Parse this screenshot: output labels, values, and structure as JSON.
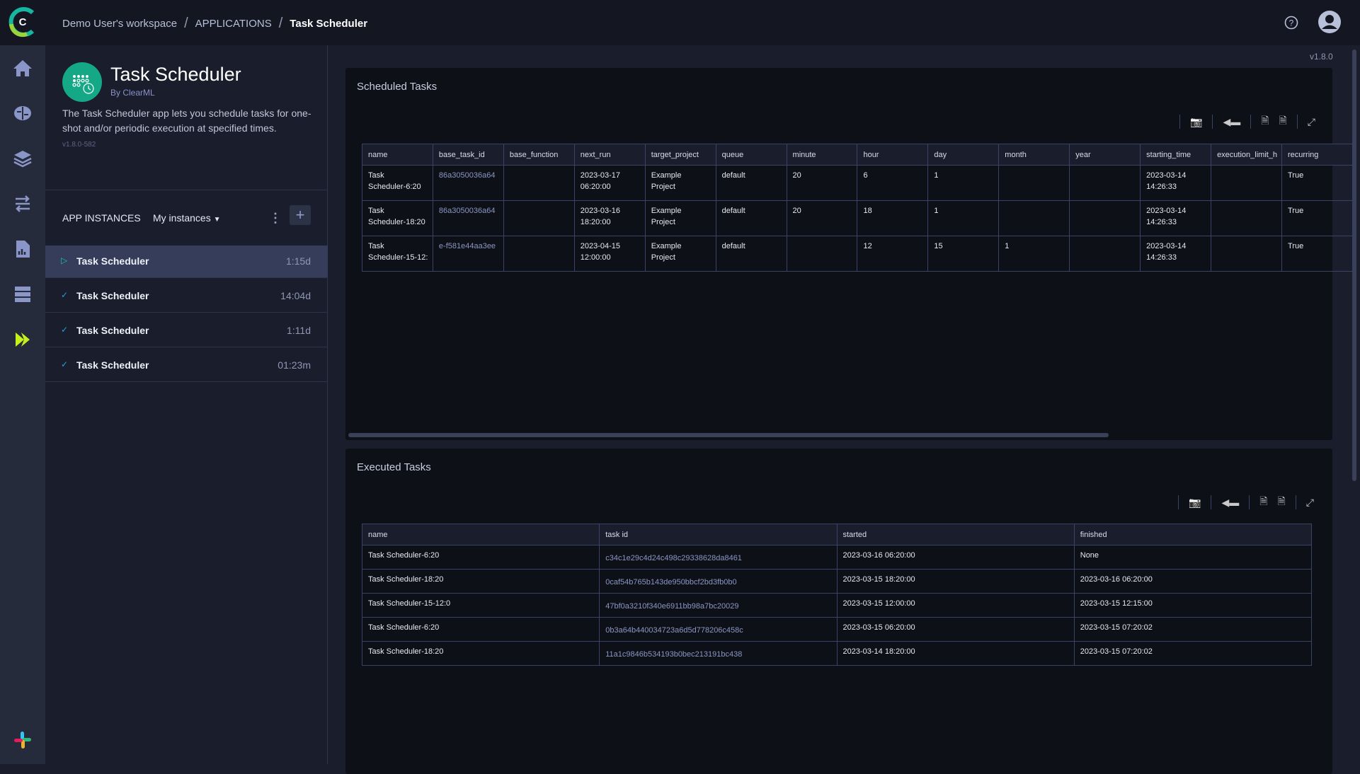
{
  "breadcrumb": {
    "workspace": "Demo User's workspace",
    "section": "APPLICATIONS",
    "current": "Task Scheduler"
  },
  "topbar": {
    "help_icon": "help-circle-icon",
    "avatar_icon": "user-avatar-icon"
  },
  "nav": [
    "home-icon",
    "brain-icon",
    "layers-icon",
    "pipelines-icon",
    "reports-icon",
    "datasets-icon",
    "applications-icon",
    "slack-icon"
  ],
  "app": {
    "title": "Task Scheduler",
    "by": "By ClearML",
    "description": "The Task Scheduler app lets you schedule tasks for one-shot and/or periodic execution at specified times.",
    "version": "v1.8.0-582"
  },
  "instances": {
    "header": "APP INSTANCES",
    "filter": "My instances",
    "add": "+",
    "kebab": "⋮",
    "items": [
      {
        "name": "Task Scheduler",
        "time": "1:15d",
        "status": "running"
      },
      {
        "name": "Task Scheduler",
        "time": "14:04d",
        "status": "completed"
      },
      {
        "name": "Task Scheduler",
        "time": "1:11d",
        "status": "completed"
      },
      {
        "name": "Task Scheduler",
        "time": "01:23m",
        "status": "completed"
      }
    ]
  },
  "version": "v1.8.0",
  "scheduled": {
    "title": "Scheduled Tasks",
    "columns": [
      "name",
      "base_task_id",
      "base_function",
      "next_run",
      "target_project",
      "queue",
      "minute",
      "hour",
      "day",
      "month",
      "year",
      "starting_time",
      "execution_limit_h",
      "recurring"
    ],
    "rows": [
      [
        "Task\nScheduler-6:20",
        "86a3050036a64",
        "",
        "2023-03-17\n06:20:00",
        "Example\nProject",
        "default",
        "20",
        "6",
        "1",
        "",
        "",
        "2023-03-14\n14:26:33",
        "",
        "True"
      ],
      [
        "Task\nScheduler-18:20",
        "86a3050036a64",
        "",
        "2023-03-16\n18:20:00",
        "Example\nProject",
        "default",
        "20",
        "18",
        "1",
        "",
        "",
        "2023-03-14\n14:26:33",
        "",
        "True"
      ],
      [
        "Task\nScheduler-15-12:",
        "e-f581e44aa3ee",
        "",
        "2023-04-15\n12:00:00",
        "Example\nProject",
        "default",
        "",
        "12",
        "15",
        "1",
        "",
        "2023-03-14\n14:26:33",
        "",
        "True"
      ]
    ]
  },
  "executed": {
    "title": "Executed Tasks",
    "columns": [
      "name",
      "task id",
      "started",
      "finished"
    ],
    "rows": [
      [
        "Task Scheduler-6:20",
        "c34c1e29c4d24c498c29338628da8461",
        "2023-03-16 06:20:00",
        "None"
      ],
      [
        "Task Scheduler-18:20",
        "0caf54b765b143de950bbcf2bd3fb0b0",
        "2023-03-15 18:20:00",
        "2023-03-16 06:20:00"
      ],
      [
        "Task Scheduler-15-12:0",
        "47bf0a3210f340e6911bb98a7bc20029",
        "2023-03-15 12:00:00",
        "2023-03-15 12:15:00"
      ],
      [
        "Task Scheduler-6:20",
        "0b3a64b440034723a6d5d778206c458c",
        "2023-03-15 06:20:00",
        "2023-03-15 07:20:02"
      ],
      [
        "Task Scheduler-18:20",
        "11a1c9846b534193b0bec213191bc438",
        "2023-03-14 18:20:00",
        "2023-03-15 07:20:02"
      ]
    ]
  },
  "toolbar_icons": [
    "camera-icon",
    "tag-icon",
    "json-file-icon",
    "csv-file-icon",
    "expand-icon"
  ],
  "colors": {
    "accent": "#14a887",
    "nav_active": "#c6f01a"
  }
}
